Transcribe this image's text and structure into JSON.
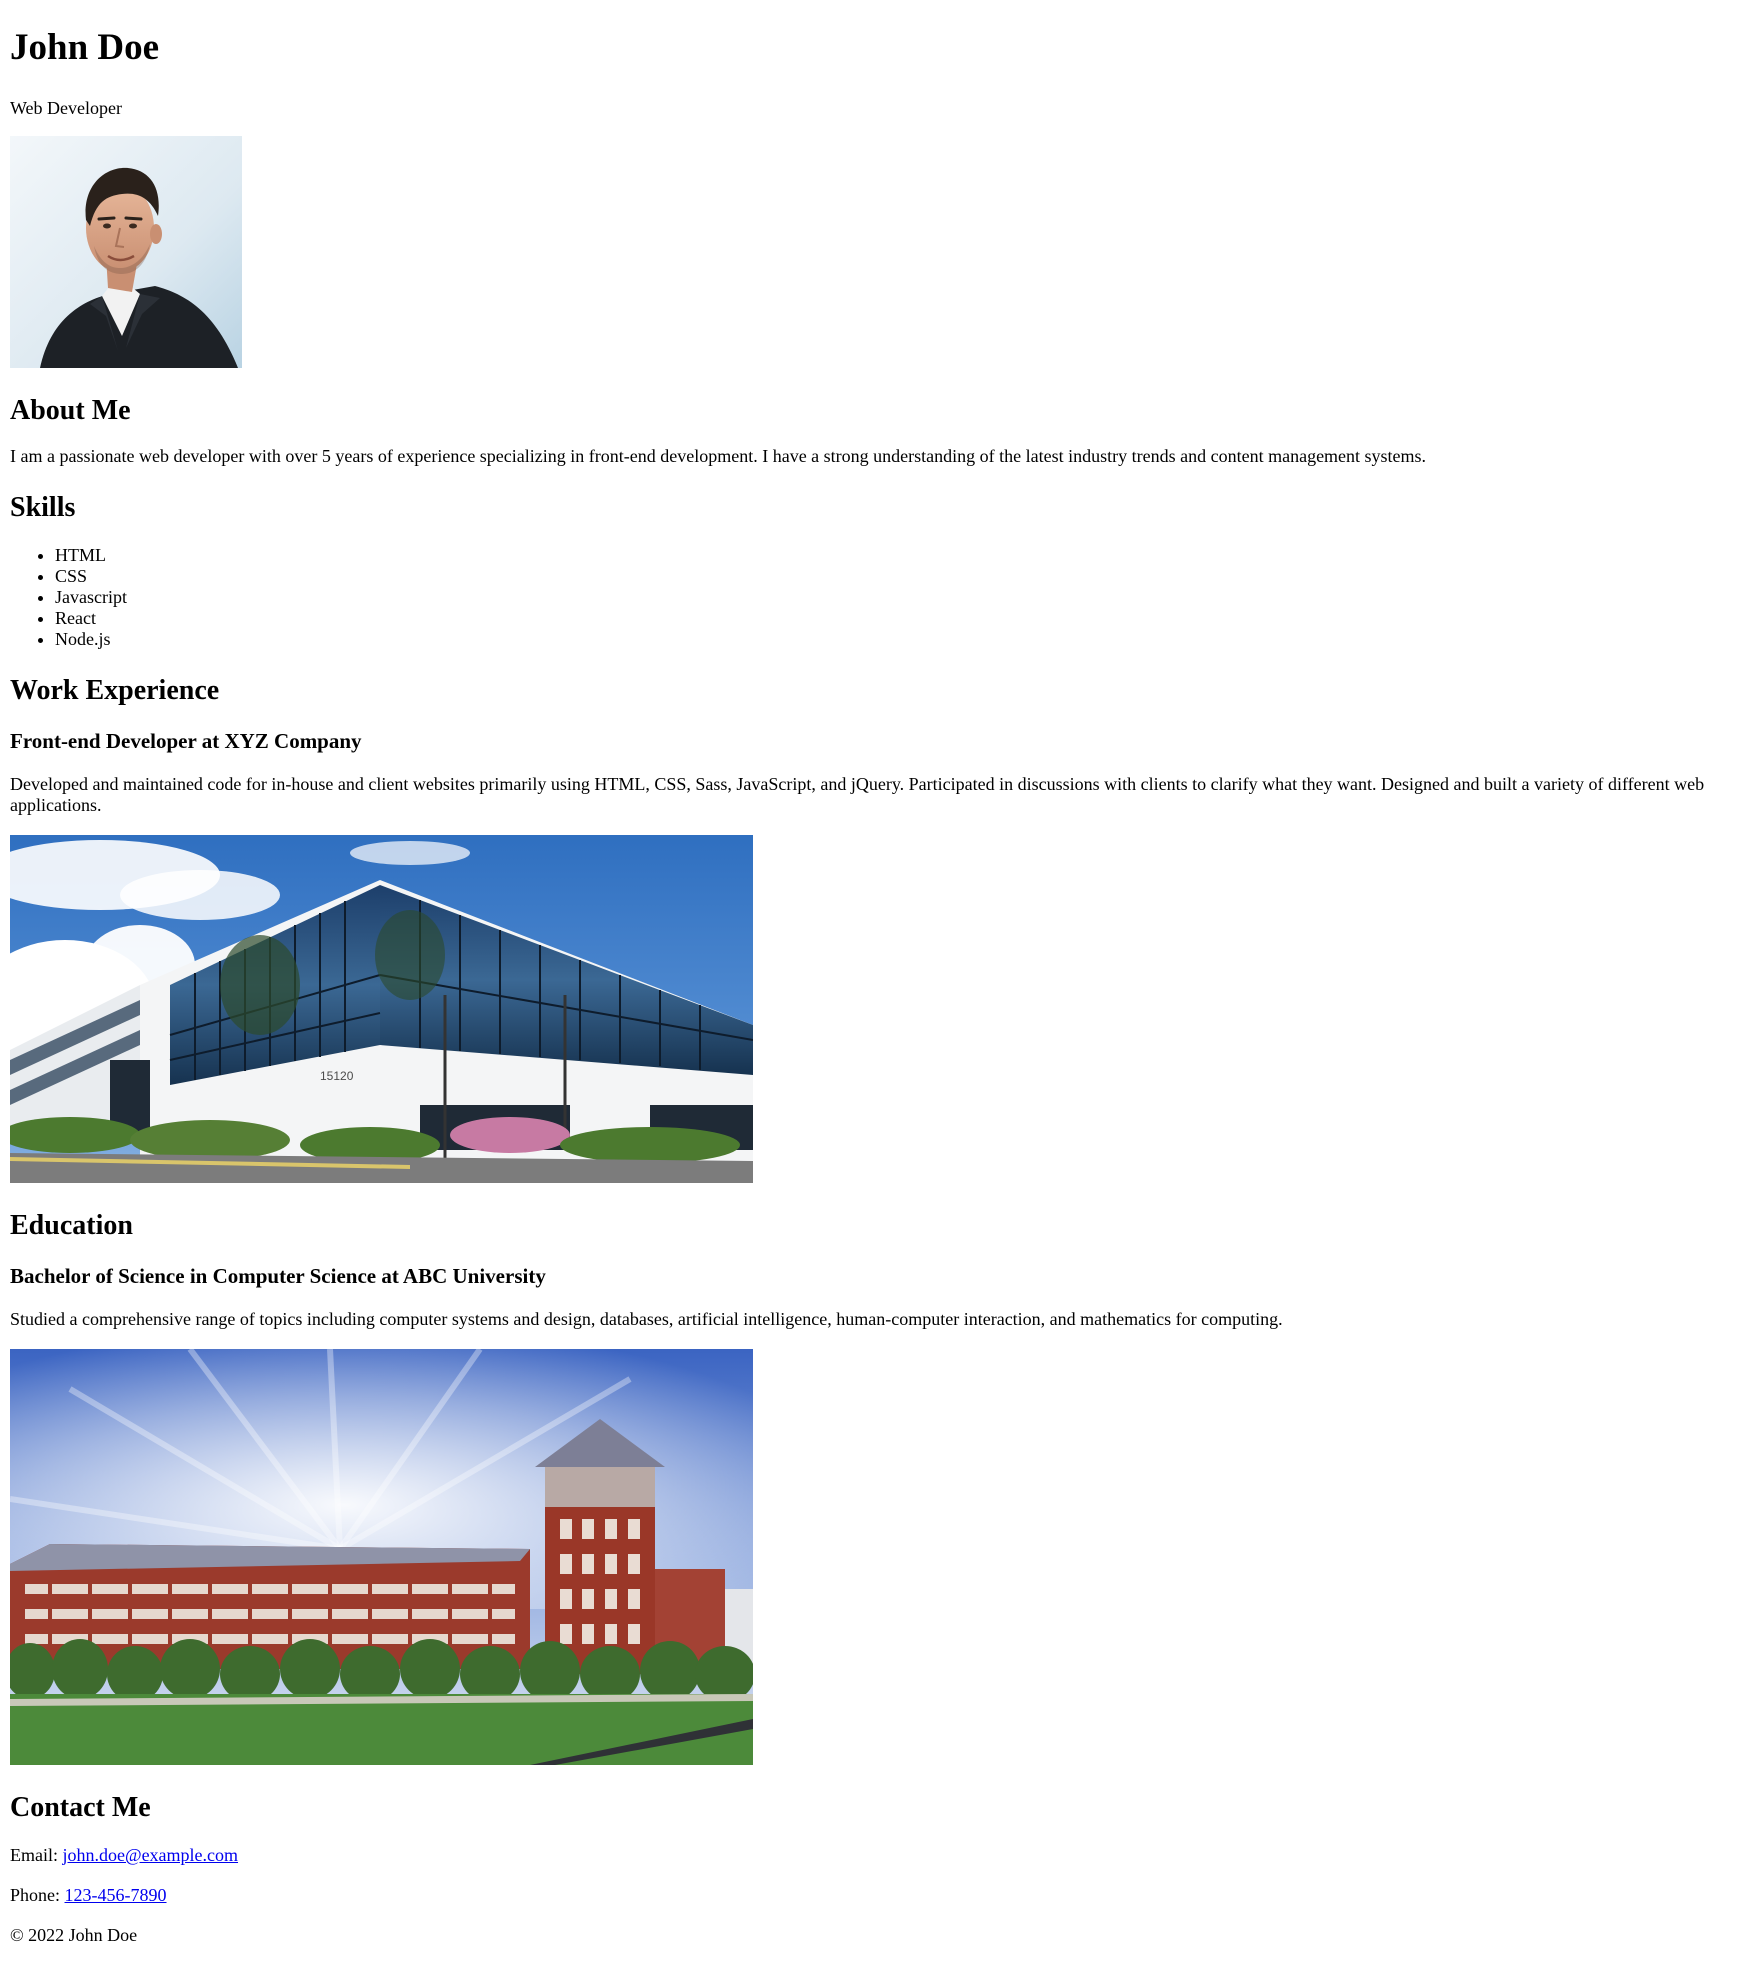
{
  "header": {
    "name": "John Doe",
    "title": "Web Developer"
  },
  "about": {
    "heading": "About Me",
    "text": "I am a passionate web developer with over 5 years of experience specializing in front-end development. I have a strong understanding of the latest industry trends and content management systems."
  },
  "skills": {
    "heading": "Skills",
    "items": [
      "HTML",
      "CSS",
      "Javascript",
      "React",
      "Node.js"
    ]
  },
  "work": {
    "heading": "Work Experience",
    "job_title": "Front-end Developer at XYZ Company",
    "description": "Developed and maintained code for in-house and client websites primarily using HTML, CSS, Sass, JavaScript, and jQuery. Participated in discussions with clients to clarify what they want. Designed and built a variety of different web applications.",
    "image_number": "15120"
  },
  "education": {
    "heading": "Education",
    "degree": "Bachelor of Science in Computer Science at ABC University",
    "description": "Studied a comprehensive range of topics including computer systems and design, databases, artificial intelligence, human-computer interaction, and mathematics for computing."
  },
  "contact": {
    "heading": "Contact Me",
    "email_label": "Email: ",
    "email": "john.doe@example.com",
    "phone_label": "Phone: ",
    "phone": "123-456-7890"
  },
  "footer": {
    "text": "© 2022 John Doe"
  },
  "colors": {
    "link": "#0000ee",
    "text": "#000000",
    "background": "#ffffff"
  }
}
